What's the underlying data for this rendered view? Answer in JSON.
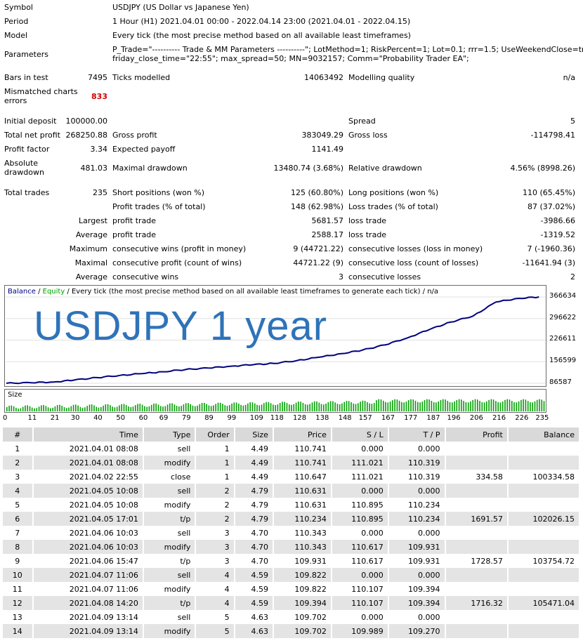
{
  "summary": {
    "symbol_label": "Symbol",
    "symbol": "USDJPY (US Dollar vs Japanese Yen)",
    "period_label": "Period",
    "period": "1 Hour (H1) 2021.04.01 00:00 - 2022.04.14 23:00 (2021.04.01 - 2022.04.15)",
    "model_label": "Model",
    "model": "Every tick (the most precise method based on all available least timeframes)",
    "parameters_label": "Parameters",
    "parameters_line1": "P_Trade=\"---------- Trade & MM Parameters ----------\"; LotMethod=1; RiskPercent=1; Lot=0.1; rrr=1.5; UseWeekendClose=true;",
    "parameters_line2": "friday_close_time=\"22:55\"; max_spread=50; MN=9032157; Comm=\"Probability Trader EA\";",
    "bars_label": "Bars in test",
    "bars": "7495",
    "ticks_label": "Ticks modelled",
    "ticks": "14063492",
    "quality_label": "Modelling quality",
    "quality": "n/a",
    "mismatch_label1": "Mismatched charts",
    "mismatch_label2": "errors",
    "mismatch": "833",
    "deposit_label": "Initial deposit",
    "deposit": "100000.00",
    "spread_label": "Spread",
    "spread": "5",
    "netprofit_label": "Total net profit",
    "netprofit": "268250.88",
    "grossprofit_label": "Gross profit",
    "grossprofit": "383049.29",
    "grossloss_label": "Gross loss",
    "grossloss": "-114798.41",
    "pf_label": "Profit factor",
    "pf": "3.34",
    "payoff_label": "Expected payoff",
    "payoff": "1141.49",
    "absdd_label1": "Absolute",
    "absdd_label2": "drawdown",
    "absdd": "481.03",
    "maxdd_label": "Maximal drawdown",
    "maxdd": "13480.74 (3.68%)",
    "reldd_label": "Relative drawdown",
    "reldd": "4.56% (8998.26)",
    "trades_label": "Total trades",
    "trades": "235",
    "short_label": "Short positions (won %)",
    "short": "125 (60.80%)",
    "long_label": "Long positions (won %)",
    "long": "110 (65.45%)",
    "ptrades_label": "Profit trades (% of total)",
    "ptrades": "148 (62.98%)",
    "ltrades_label": "Loss trades (% of total)",
    "ltrades": "87 (37.02%)",
    "largest_label": "Largest",
    "largest_profit_label": "profit trade",
    "largest_profit": "5681.57",
    "largest_loss_label": "loss trade",
    "largest_loss": "-3986.66",
    "average_label": "Average",
    "average_profit_label": "profit trade",
    "average_profit": "2588.17",
    "average_loss_label": "loss trade",
    "average_loss": "-1319.52",
    "maximum_label": "Maximum",
    "max_cw_label": "consecutive wins (profit in money)",
    "max_cw": "9 (44721.22)",
    "max_cl_label": "consecutive losses (loss in money)",
    "max_cl": "7 (-1960.36)",
    "maximal_label": "Maximal",
    "maximal_cp_label": "consecutive profit (count of wins)",
    "maximal_cp": "44721.22 (9)",
    "maximal_cl_label": "consecutive loss (count of losses)",
    "maximal_cl": "-11641.94 (3)",
    "avgc_label": "Average",
    "avg_cw_label": "consecutive wins",
    "avg_cw": "3",
    "avg_cl_label": "consecutive losses",
    "avg_cl": "2"
  },
  "chart": {
    "legend_balance": "Balance",
    "legend_sep": " / ",
    "legend_equity": "Equity",
    "legend_rest": " / Every tick (the most precise method based on all available least timeframes to generate each tick) / n/a",
    "overlay_text": "USDJPY 1 year",
    "size_label": "Size",
    "colors": {
      "balance": "#00007f",
      "equity": "#00a000",
      "overlay": "#2f73b8",
      "size_bars": "#00a000"
    }
  },
  "chart_data": {
    "type": "line",
    "series": [
      {
        "name": "Balance",
        "x": [
          0,
          11,
          21,
          30,
          40,
          50,
          60,
          69,
          79,
          89,
          99,
          109,
          118,
          128,
          138,
          148,
          157,
          167,
          177,
          187,
          196,
          206,
          216,
          226,
          235
        ],
        "values": [
          86587,
          88500,
          91000,
          97000,
          105000,
          112000,
          118000,
          124000,
          131000,
          136000,
          142000,
          147000,
          151000,
          160000,
          171000,
          183000,
          194000,
          211000,
          234000,
          262000,
          285000,
          305000,
          350000,
          362000,
          366634
        ]
      }
    ],
    "y_ticks": [
      "366634",
      "296622",
      "226611",
      "156599",
      "86587"
    ],
    "ylim": [
      86587,
      366634
    ],
    "x_ticks": [
      "0",
      "11",
      "21",
      "30",
      "40",
      "50",
      "60",
      "69",
      "79",
      "89",
      "99",
      "109",
      "118",
      "128",
      "138",
      "148",
      "157",
      "167",
      "177",
      "187",
      "196",
      "206",
      "216",
      "226",
      "235"
    ],
    "xlim": [
      0,
      238
    ],
    "size_series": {
      "name": "Size",
      "x_start": 0,
      "x_end": 235
    }
  },
  "table": {
    "headers": [
      "#",
      "Time",
      "Type",
      "Order",
      "Size",
      "Price",
      "S / L",
      "T / P",
      "Profit",
      "Balance"
    ],
    "rows": [
      [
        "1",
        "2021.04.01 08:08",
        "sell",
        "1",
        "4.49",
        "110.741",
        "0.000",
        "0.000",
        "",
        ""
      ],
      [
        "2",
        "2021.04.01 08:08",
        "modify",
        "1",
        "4.49",
        "110.741",
        "111.021",
        "110.319",
        "",
        ""
      ],
      [
        "3",
        "2021.04.02 22:55",
        "close",
        "1",
        "4.49",
        "110.647",
        "111.021",
        "110.319",
        "334.58",
        "100334.58"
      ],
      [
        "4",
        "2021.04.05 10:08",
        "sell",
        "2",
        "4.79",
        "110.631",
        "0.000",
        "0.000",
        "",
        ""
      ],
      [
        "5",
        "2021.04.05 10:08",
        "modify",
        "2",
        "4.79",
        "110.631",
        "110.895",
        "110.234",
        "",
        ""
      ],
      [
        "6",
        "2021.04.05 17:01",
        "t/p",
        "2",
        "4.79",
        "110.234",
        "110.895",
        "110.234",
        "1691.57",
        "102026.15"
      ],
      [
        "7",
        "2021.04.06 10:03",
        "sell",
        "3",
        "4.70",
        "110.343",
        "0.000",
        "0.000",
        "",
        ""
      ],
      [
        "8",
        "2021.04.06 10:03",
        "modify",
        "3",
        "4.70",
        "110.343",
        "110.617",
        "109.931",
        "",
        ""
      ],
      [
        "9",
        "2021.04.06 15:47",
        "t/p",
        "3",
        "4.70",
        "109.931",
        "110.617",
        "109.931",
        "1728.57",
        "103754.72"
      ],
      [
        "10",
        "2021.04.07 11:06",
        "sell",
        "4",
        "4.59",
        "109.822",
        "0.000",
        "0.000",
        "",
        ""
      ],
      [
        "11",
        "2021.04.07 11:06",
        "modify",
        "4",
        "4.59",
        "109.822",
        "110.107",
        "109.394",
        "",
        ""
      ],
      [
        "12",
        "2021.04.08 14:20",
        "t/p",
        "4",
        "4.59",
        "109.394",
        "110.107",
        "109.394",
        "1716.32",
        "105471.04"
      ],
      [
        "13",
        "2021.04.09 13:14",
        "sell",
        "5",
        "4.63",
        "109.702",
        "0.000",
        "0.000",
        "",
        ""
      ],
      [
        "14",
        "2021.04.09 13:14",
        "modify",
        "5",
        "4.63",
        "109.702",
        "109.989",
        "109.270",
        "",
        ""
      ]
    ]
  }
}
